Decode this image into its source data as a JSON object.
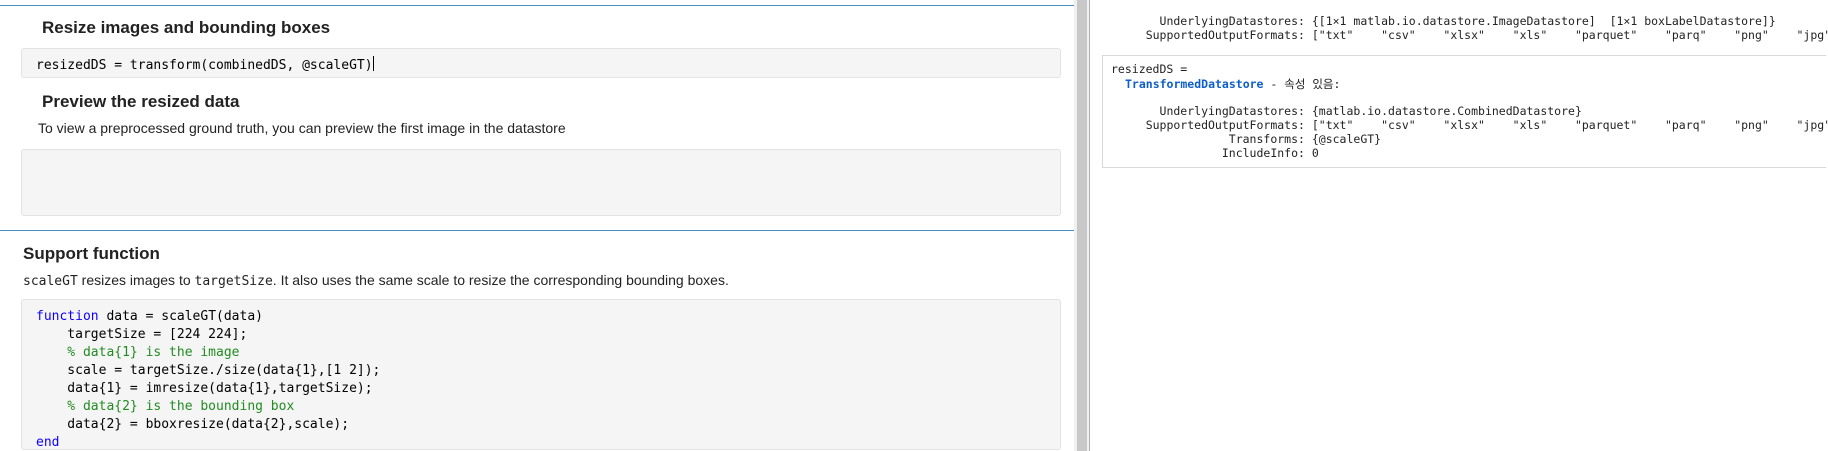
{
  "editor": {
    "section1": {
      "heading": "Resize images and bounding boxes",
      "code": "resizedDS = transform(combinedDS, @scaleGT)"
    },
    "section2": {
      "heading": "Preview the resized data",
      "body": "To view a preprocessed ground truth, you can preview the first image in the datastore"
    },
    "section3": {
      "heading": "Support function",
      "body_code1": "scaleGT",
      "body_text1": " resizes images to ",
      "body_code2": "targetSize",
      "body_text2": ". It also uses the same scale to resize the corresponding bounding boxes.",
      "code": {
        "l1_kw": "function",
        "l1_rest": " data = scaleGT(data)",
        "l2": "    targetSize = [224 224];",
        "l3": "    % data{1} is the image",
        "l4": "    scale = targetSize./size(data{1},[1 2]);",
        "l5": "    data{1} = imresize(data{1},targetSize);",
        "l6": "    % data{2} is the bounding box",
        "l7": "    data{2} = bboxresize(data{2},scale);",
        "l8_kw": "end"
      }
    }
  },
  "output": {
    "top_underlying": "      UnderlyingDatastores: {[1×1 matlab.io.datastore.ImageDatastore]  [1×1 boxLabelDatastore]}",
    "top_formats": "    SupportedOutputFormats: [\"txt\"    \"csv\"    \"xlsx\"    \"xls\"    \"parquet\"    \"parq\"    \"png\"    \"jpg\"    \"",
    "var_line": "resizedDS =",
    "class_name": "TransformedDatastore",
    "class_suffix": " - 속성 있음:",
    "underlying": "      UnderlyingDatastores: {matlab.io.datastore.CombinedDatastore}",
    "formats": "    SupportedOutputFormats: [\"txt\"    \"csv\"    \"xlsx\"    \"xls\"    \"parquet\"    \"parq\"    \"png\"    \"jpg\"    \"",
    "transforms": "                Transforms: {@scaleGT}",
    "includeinfo": "               IncludeInfo: 0"
  },
  "colors": {
    "keyword": "#0e00ff",
    "comment": "#228b22",
    "link": "#0e5ec9",
    "section_rule": "#4a90c8"
  }
}
